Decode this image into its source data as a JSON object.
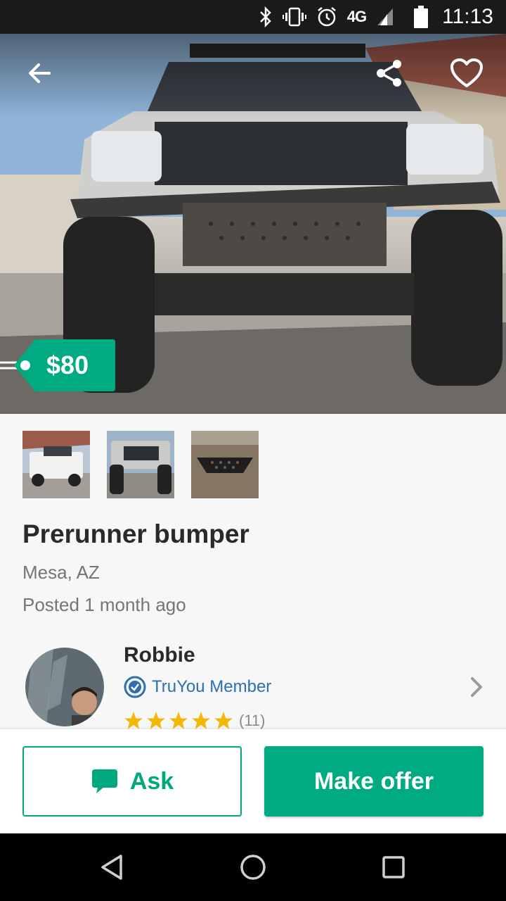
{
  "status_bar": {
    "network": "4G",
    "time": "11:13",
    "icons": [
      "bluetooth-icon",
      "vibrate-icon",
      "alarm-icon",
      "network-4g-icon",
      "signal-icon",
      "battery-icon"
    ]
  },
  "hero": {
    "icons": [
      "back-arrow-icon",
      "share-icon",
      "heart-icon"
    ]
  },
  "listing": {
    "price": "$80",
    "title": "Prerunner bumper",
    "location": "Mesa, AZ",
    "posted": "Posted 1 month ago",
    "thumbnail_count": 3
  },
  "seller": {
    "name": "Robbie",
    "badge": "TruYou Member",
    "rating_stars": 5,
    "rating_count": "(11)"
  },
  "actions": {
    "ask_label": "Ask",
    "offer_label": "Make offer"
  },
  "colors": {
    "accent": "#00a87e",
    "link_blue": "#2c6fb5",
    "star": "#f5b800"
  }
}
